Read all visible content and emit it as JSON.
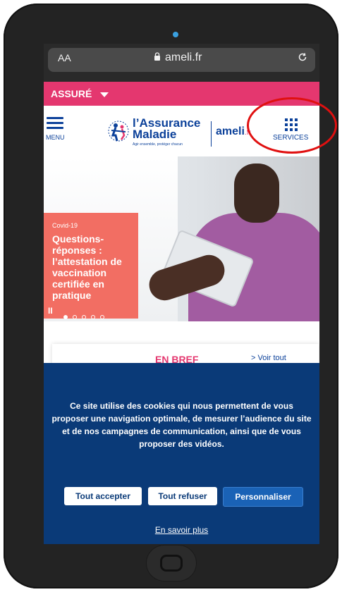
{
  "browser": {
    "text_size_label": "AA",
    "url": "ameli.fr"
  },
  "assure_bar": {
    "label": "ASSURÉ"
  },
  "header": {
    "menu_label": "MENU",
    "logo_line1": "l’Assurance",
    "logo_line2": "Maladie",
    "logo_tagline": "Agir ensemble, protéger chacun",
    "ameli_label": "ameli",
    "ameli_suffix": ".fr",
    "services_label": "SERVICES"
  },
  "hero": {
    "tag": "Covid-19",
    "title": "Questions-réponses : l’attestation de vaccination certifiée en pratique",
    "pause_label": "II",
    "slide_count": 5,
    "active_slide": 1
  },
  "enbref": {
    "title": "EN BREF",
    "voir_tout": "> Voir tout"
  },
  "cookie_banner": {
    "message": "Ce site utilise des cookies qui nous permettent de vous proposer une navigation optimale, de mesurer l’audience du site et de nos campagnes de communication, ainsi que de vous proposer des vidéos.",
    "accept_label": "Tout accepter",
    "refuse_label": "Tout refuser",
    "customize_label": "Personnaliser",
    "more_label": "En savoir plus"
  },
  "colors": {
    "brand_blue": "#0c419a",
    "brand_pink": "#e4376f",
    "covid_card": "#f26e63",
    "cookie_bg": "#0a3a78",
    "highlight_circle": "#e01010"
  }
}
